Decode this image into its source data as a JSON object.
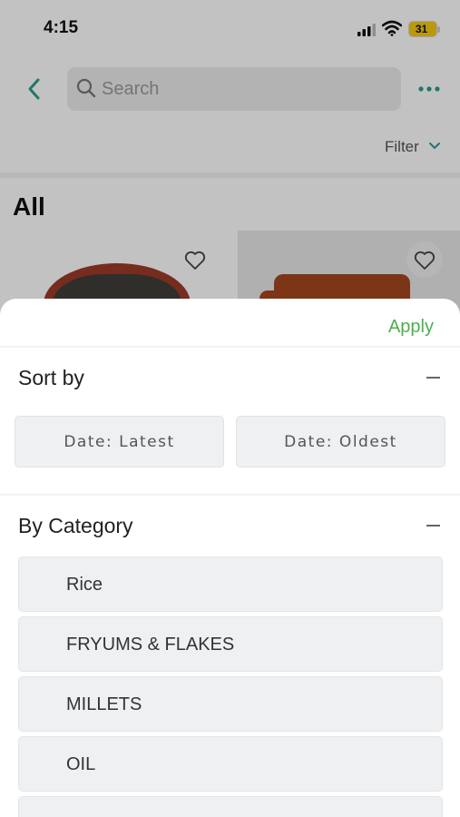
{
  "status_bar": {
    "time": "4:15",
    "battery": "31"
  },
  "header": {
    "search_placeholder": "Search"
  },
  "toolbar": {
    "filter_label": "Filter"
  },
  "section": {
    "title": "All"
  },
  "sheet": {
    "apply_label": "Apply",
    "sort_by": {
      "title": "Sort by",
      "options": [
        "Date: Latest",
        "Date: Oldest"
      ]
    },
    "by_category": {
      "title": "By Category",
      "items": [
        "Rice",
        "FRYUMS & FLAKES",
        "MILLETS",
        "OIL"
      ]
    }
  },
  "colors": {
    "accent": "#4caf50",
    "back_arrow": "#2a9d8f",
    "chip_bg": "#eef0f2"
  }
}
